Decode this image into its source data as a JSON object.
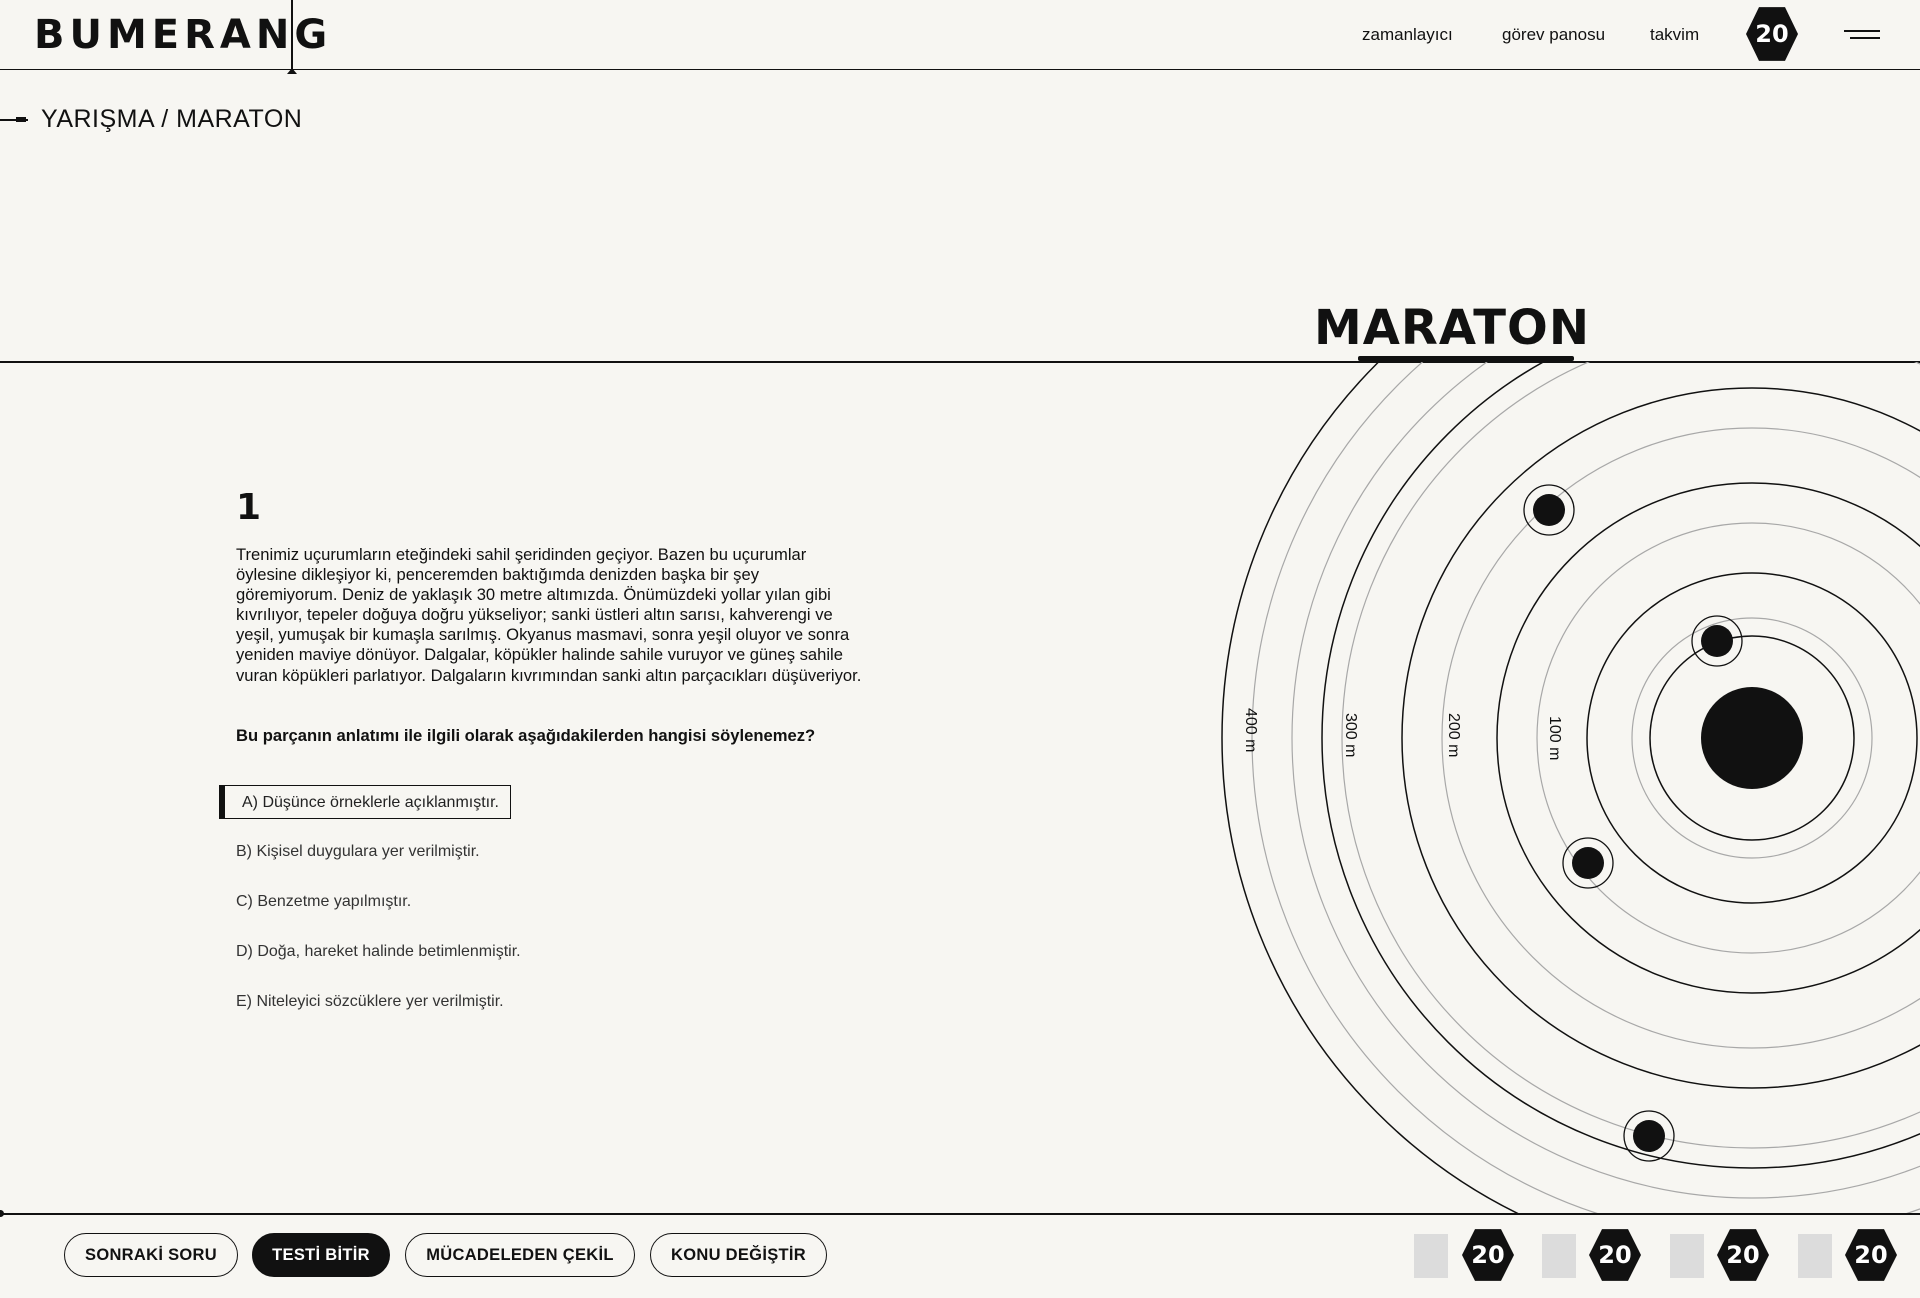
{
  "header": {
    "logo": "BUMERANG",
    "nav": [
      "zamanlayıcı",
      "görev panosu",
      "takvim"
    ],
    "badge": "20"
  },
  "breadcrumb": "YARIŞMA / MARATON",
  "section": {
    "title": "MARATON"
  },
  "orbit": {
    "ring_labels": [
      "400 m",
      "300 m",
      "200 m",
      "100 m"
    ]
  },
  "question": {
    "number": "1",
    "passage": "Trenimiz uçurumların eteğindeki sahil şeridinden geçiyor. Bazen bu uçurumlar öylesine dikleşiyor ki, penceremden baktığımda denizden başka bir şey göremiyorum. Deniz de yaklaşık 30 metre altımızda. Önümüzdeki yollar yılan gibi kıvrılıyor, tepeler doğuya doğru yükseliyor; sanki üstleri altın sarısı, kahverengi ve yeşil, yumuşak bir kumaşla sarılmış. Okyanus masmavi, sonra yeşil oluyor ve sonra yeniden maviye dönüyor. Dalgalar, köpükler halinde sahile vuruyor ve güneş sahile vuran köpükleri parlatıyor. Dalgaların kıvrımından sanki altın parçacıkları düşüveriyor.",
    "prompt": "Bu parçanın anlatımı ile ilgili olarak aşağıdakilerden hangisi söylenemez?",
    "options": [
      "A) Düşünce örneklerle açıklanmıştır.",
      "B) Kişisel duygulara yer verilmiştir.",
      "C) Benzetme yapılmıştır.",
      "D) Doğa, hareket halinde betimlenmiştir.",
      "E) Niteleyici sözcüklere yer verilmiştir."
    ],
    "selected": "A"
  },
  "footer": {
    "buttons": {
      "next": "SONRAKİ SORU",
      "finish": "TESTİ BİTİR",
      "withdraw": "MÜCADELEDEN ÇEKİL",
      "change_topic": "KONU DEĞİŞTİR"
    },
    "counters": [
      "20",
      "20",
      "20",
      "20"
    ]
  },
  "colors": {
    "background": "#f7f6f2",
    "ink": "#111111",
    "muted_ring": "#a8a8a8",
    "placeholder": "#dcdcdc"
  }
}
